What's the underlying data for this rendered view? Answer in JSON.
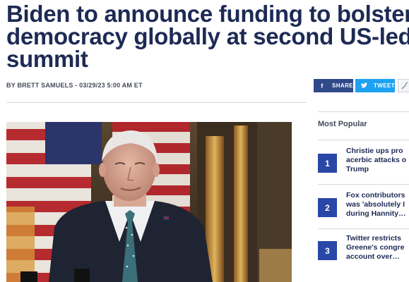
{
  "article": {
    "headline_lines": [
      "Biden to announce funding to bolster",
      "democracy globally at second US-led",
      "summit"
    ],
    "byline": "BY BRETT SAMUELS - 03/29/23 5:00 AM ET"
  },
  "share": {
    "share_label": "SHARE",
    "tweet_label": "TWEET",
    "share_icon": "facebook-icon",
    "tweet_icon": "twitter-icon",
    "link_icon": "link-icon"
  },
  "most_popular": {
    "title": "Most Popular",
    "items": [
      {
        "num": "1",
        "lines": [
          "Christie ups pro",
          "acerbic attacks o",
          "Trump"
        ]
      },
      {
        "num": "2",
        "lines": [
          "Fox contributors",
          "was 'absolutely I",
          "during Hannity…"
        ]
      },
      {
        "num": "3",
        "lines": [
          "Twitter restricts",
          "Greene's congre",
          "account over…"
        ]
      }
    ]
  },
  "colors": {
    "headline": "#1d2a55",
    "share_bg": "#2f4a8a",
    "tweet_bg": "#1da1f2",
    "rank_bg": "#2847a6"
  }
}
